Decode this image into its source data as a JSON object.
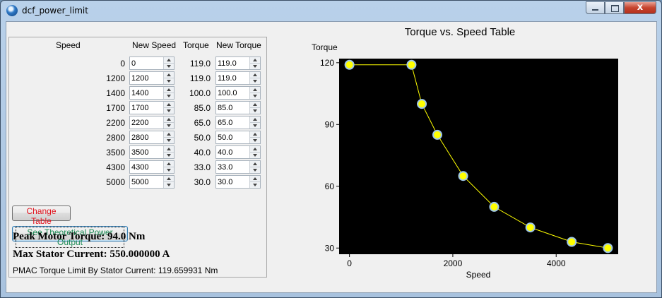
{
  "window": {
    "title": "dcf_power_limit",
    "buttons": {
      "minimize": "",
      "maximize": "",
      "close": "x"
    }
  },
  "table": {
    "headers": {
      "speed": "Speed",
      "new_speed": "New Speed",
      "torque": "Torque",
      "new_torque": "New Torque"
    },
    "rows": [
      {
        "speed": "0",
        "new_speed": "0",
        "torque": "119.0",
        "new_torque": "119.0"
      },
      {
        "speed": "1200",
        "new_speed": "1200",
        "torque": "119.0",
        "new_torque": "119.0"
      },
      {
        "speed": "1400",
        "new_speed": "1400",
        "torque": "100.0",
        "new_torque": "100.0"
      },
      {
        "speed": "1700",
        "new_speed": "1700",
        "torque": "85.0",
        "new_torque": "85.0"
      },
      {
        "speed": "2200",
        "new_speed": "2200",
        "torque": "65.0",
        "new_torque": "65.0"
      },
      {
        "speed": "2800",
        "new_speed": "2800",
        "torque": "50.0",
        "new_torque": "50.0"
      },
      {
        "speed": "3500",
        "new_speed": "3500",
        "torque": "40.0",
        "new_torque": "40.0"
      },
      {
        "speed": "4300",
        "new_speed": "4300",
        "torque": "33.0",
        "new_torque": "33.0"
      },
      {
        "speed": "5000",
        "new_speed": "5000",
        "torque": "30.0",
        "new_torque": "30.0"
      }
    ]
  },
  "buttons": {
    "change_table": "Change Table",
    "see_power": "See Theoretical Power Output"
  },
  "info": {
    "peak_torque": "Peak Motor Torque: 94.0 Nm",
    "max_current": "Max Stator Current: 550.000000 A",
    "pmac_limit": "PMAC Torque Limit By Stator Current: 119.659931 Nm"
  },
  "chart_data": {
    "type": "line",
    "title": "Torque vs. Speed Table",
    "xlabel": "Speed",
    "ylabel": "Torque",
    "x": [
      0,
      1200,
      1400,
      1700,
      2200,
      2800,
      3500,
      4300,
      5000
    ],
    "series": [
      {
        "values": [
          119,
          119,
          100,
          85,
          65,
          50,
          40,
          33,
          30
        ]
      }
    ],
    "xlim": [
      -200,
      5200
    ],
    "ylim": [
      27,
      122
    ],
    "xticks": [
      "0",
      "2000",
      "4000"
    ],
    "xtick_values": [
      0,
      2000,
      4000
    ],
    "yticks": [
      "120",
      "90",
      "60",
      "30"
    ],
    "ytick_values": [
      120,
      90,
      60,
      30
    ],
    "grid": false,
    "colors": {
      "background": "#000000",
      "line": "#ffff00",
      "marker_fill": "#ffff00",
      "marker_edge": "#9ec6e8"
    }
  }
}
